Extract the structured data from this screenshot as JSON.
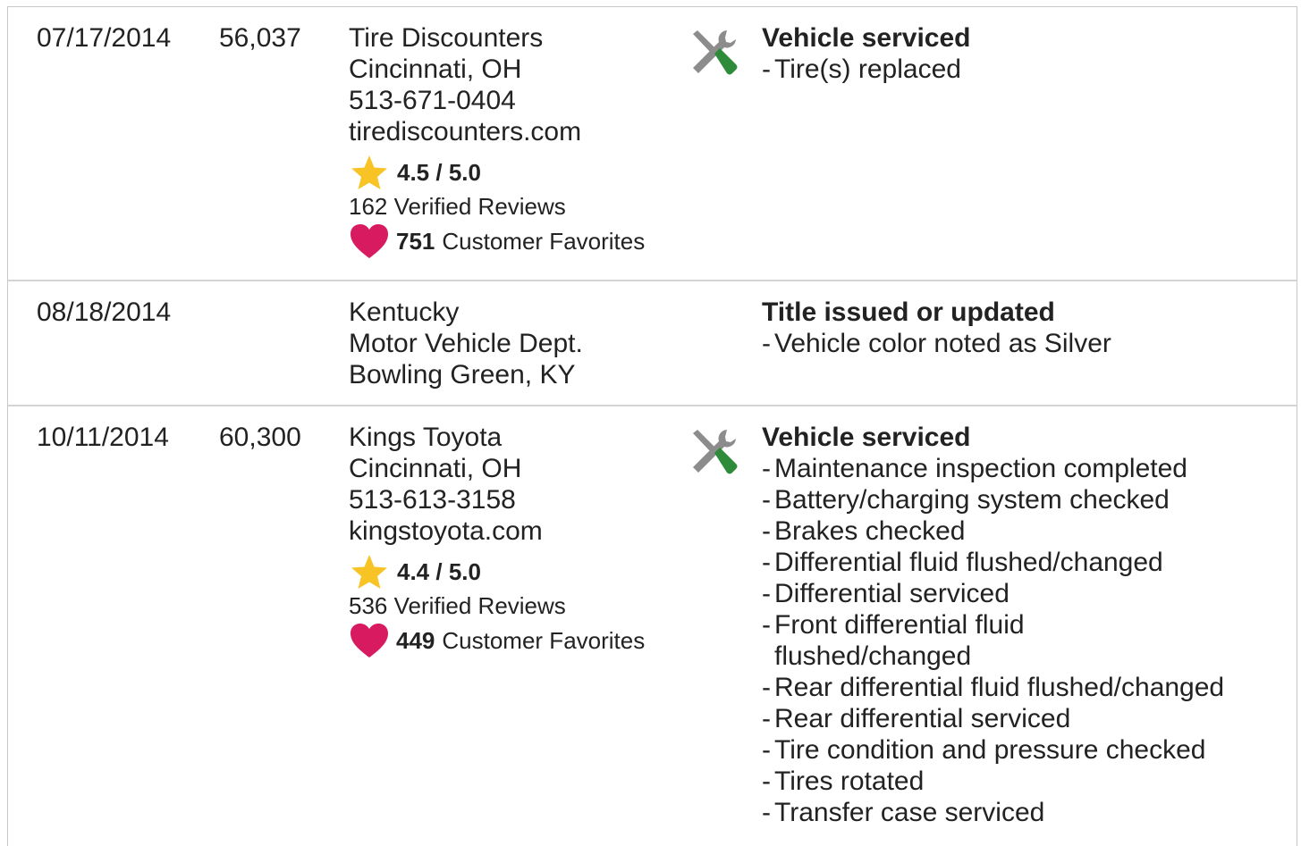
{
  "records": [
    {
      "date": "07/17/2014",
      "odometer": "56,037",
      "source": {
        "lines": [
          "Tire Discounters",
          "Cincinnati, OH",
          "513-671-0404",
          "tirediscounters.com"
        ],
        "rating": "4.5 / 5.0",
        "reviews": "162 Verified Reviews",
        "favorites_count": "751",
        "favorites_label": "Customer Favorites"
      },
      "icon": "service-tools-icon",
      "detail_title": "Vehicle serviced",
      "details": [
        "Tire(s) replaced"
      ]
    },
    {
      "date": "08/18/2014",
      "odometer": "",
      "source": {
        "lines": [
          "Kentucky",
          "Motor Vehicle Dept.",
          "Bowling Green, KY"
        ]
      },
      "detail_title": "Title issued or updated",
      "details": [
        "Vehicle color noted as Silver"
      ]
    },
    {
      "date": "10/11/2014",
      "odometer": "60,300",
      "source": {
        "lines": [
          "Kings Toyota",
          "Cincinnati, OH",
          "513-613-3158",
          "kingstoyota.com"
        ],
        "rating": "4.4 / 5.0",
        "reviews": "536 Verified Reviews",
        "favorites_count": "449",
        "favorites_label": "Customer Favorites"
      },
      "icon": "service-tools-icon",
      "detail_title": "Vehicle serviced",
      "details": [
        "Maintenance inspection completed",
        "Battery/charging system checked",
        "Brakes checked",
        "Differential fluid flushed/changed",
        "Differential serviced",
        "Front differential fluid flushed/changed",
        "Rear differential fluid flushed/changed",
        "Rear differential serviced",
        "Tire condition and pressure checked",
        "Tires rotated",
        "Transfer case serviced"
      ]
    }
  ],
  "colors": {
    "star": "#f7c325",
    "heart": "#d81b60",
    "tool_grey": "#8c8c8c",
    "tool_green": "#2e8b3a",
    "border": "#c8c8c8"
  }
}
